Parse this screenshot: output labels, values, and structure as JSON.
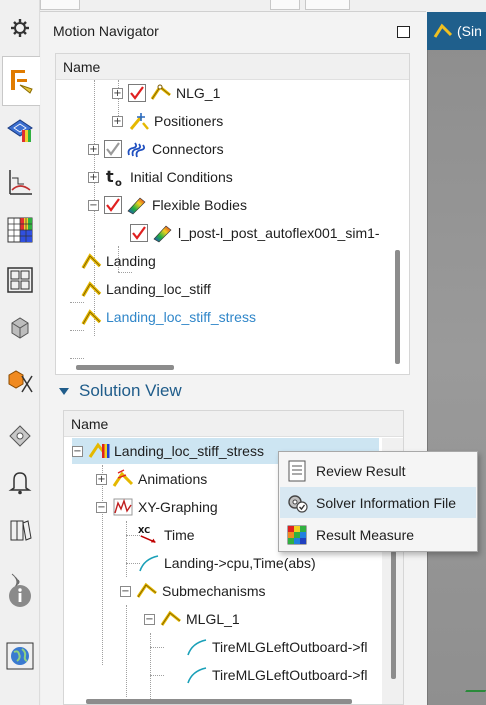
{
  "graphics_tab": {
    "label": "(Sin"
  },
  "left_toolbar": [
    {
      "name": "gear-icon"
    },
    {
      "name": "motion-navigator-icon",
      "active": true
    },
    {
      "name": "mesh-results-icon"
    },
    {
      "name": "xy-graph-icon"
    },
    {
      "name": "color-grid-icon"
    },
    {
      "name": "layout-grid-icon"
    },
    {
      "name": "cube-icon"
    },
    {
      "name": "cube-constraint-icon"
    },
    {
      "name": "bracket-icon"
    },
    {
      "name": "bell-icon"
    },
    {
      "name": "book-icon"
    },
    {
      "name": "signal-icon"
    },
    {
      "name": "info-icon"
    },
    {
      "name": "globe-icon"
    }
  ],
  "navigator": {
    "title": "Motion Navigator",
    "column_header": "Name",
    "items": [
      {
        "label": "NLG_1",
        "expander": "+",
        "checked": true,
        "icon": "mechanism-icon"
      },
      {
        "label": "Positioners",
        "expander": "+",
        "checked": false,
        "icon": "positioner-icon"
      },
      {
        "label": "Connectors",
        "expander": "+",
        "checked": true,
        "checked_gray": true,
        "icon": "spring-icon"
      },
      {
        "label": "Initial Conditions",
        "expander": "+",
        "icon": "initial-conditions-icon"
      },
      {
        "label": "Flexible Bodies",
        "expander": "−",
        "checked": true,
        "icon": "flexible-body-icon"
      },
      {
        "label": "l_post-l_post_autoflex001_sim1-",
        "checked": true,
        "icon": "flexible-body-icon"
      },
      {
        "label": "Landing",
        "icon": "solution-icon"
      },
      {
        "label": "Landing_loc_stiff",
        "icon": "solution-icon"
      },
      {
        "label": "Landing_loc_stiff_stress",
        "icon": "solution-icon",
        "active": true
      }
    ]
  },
  "solution_view": {
    "title": "Solution View",
    "column_header": "Name",
    "items": [
      {
        "label": "Landing_loc_stiff_stress",
        "expander": "−",
        "icon": "results-icon",
        "selected": true
      },
      {
        "label": "Animations",
        "expander": "+",
        "icon": "animation-icon"
      },
      {
        "label": "XY-Graphing",
        "expander": "−",
        "icon": "xy-graph-icon"
      },
      {
        "label": "Time",
        "icon": "xc-axis-icon"
      },
      {
        "label": "Landing->cpu,Time(abs)",
        "icon": "curve-icon"
      },
      {
        "label": "Submechanisms",
        "expander": "−",
        "icon": "mechanism-icon"
      },
      {
        "label": "MLGL_1",
        "expander": "−",
        "icon": "mechanism-icon"
      },
      {
        "label": "TireMLGLeftOutboard->fl",
        "icon": "curve-icon"
      },
      {
        "label": "TireMLGLeftOutboard->fl",
        "icon": "curve-icon"
      }
    ]
  },
  "context_menu": {
    "items": [
      {
        "label": "Review Result",
        "icon": "review-result-icon"
      },
      {
        "label": "Solver Information File",
        "icon": "solver-info-icon",
        "highlighted": true
      },
      {
        "label": "Result Measure",
        "icon": "result-measure-icon"
      }
    ]
  },
  "colors": {
    "accent": "#1f5c8a",
    "selection": "#cde5f2",
    "menu_highlight": "#d8e8f2",
    "active_link": "#2f86c9"
  }
}
